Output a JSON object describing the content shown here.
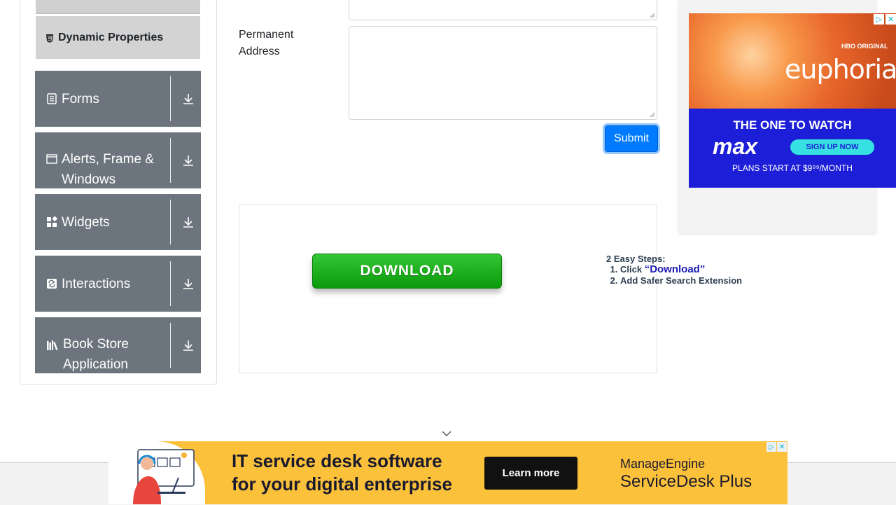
{
  "sidebar": {
    "sub_item": {
      "label": "Dynamic Properties",
      "icon": "html5-icon"
    },
    "groups": [
      {
        "label": "Forms",
        "icon": "document-icon"
      },
      {
        "label": "Alerts, Frame & Windows",
        "icon": "window-icon"
      },
      {
        "label": "Widgets",
        "icon": "widgets-icon"
      },
      {
        "label": "Interactions",
        "icon": "interactions-icon"
      },
      {
        "label": "Book Store Application",
        "icon": "books-icon"
      }
    ]
  },
  "form": {
    "permanent_address_label": "Permanent Address",
    "submit_label": "Submit"
  },
  "inline_ad": {
    "button_label": "DOWNLOAD",
    "steps_title": "2 Easy Steps:",
    "step1_prefix": "Click ",
    "step1_word": "“Download”",
    "step2": "Add Safer Search Extension"
  },
  "right_ad": {
    "network": "HBO ORIGINAL",
    "show": "euphoria",
    "tagline": "THE ONE TO WATCH",
    "brand": "max",
    "cta": "SIGN UP NOW",
    "price": "PLANS START AT $9⁹⁹/MONTH",
    "colors": {
      "accent_blue": "#1d1fd8",
      "cta_cyan": "#37e1e1"
    }
  },
  "bottom_ad": {
    "headline_line1": "IT service desk software",
    "headline_line2": "for your digital enterprise",
    "cta": "Learn more",
    "brand_line1": "ManageEngine",
    "brand_line2": "ServiceDesk Plus",
    "colors": {
      "background": "#fcc13a"
    }
  },
  "colors": {
    "sidebar_group": "#6c757d",
    "sidebar_sub_item": "#d3d3d3",
    "submit_button": "#007bff",
    "download_button": "#1bb31b"
  }
}
